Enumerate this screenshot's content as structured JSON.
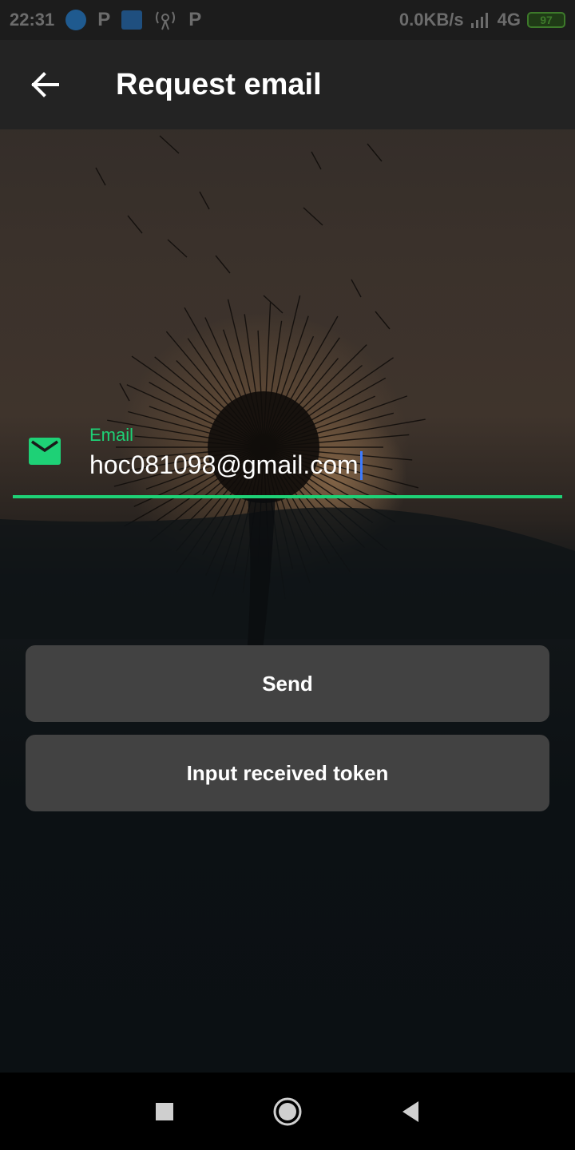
{
  "status_bar": {
    "time": "22:31",
    "net_speed": "0.0KB/s",
    "network": "4G",
    "battery": "97",
    "icons": [
      "wifi-icon",
      "p-notification-icon",
      "hotspot-icon",
      "signal-tower-icon",
      "p-notification-icon",
      "signal-bars-icon",
      "battery-icon"
    ],
    "p_label": "P"
  },
  "app_bar": {
    "title": "Request email",
    "back_icon": "arrow-left-icon"
  },
  "email_field": {
    "label": "Email",
    "value": "hoc081098@gmail.com",
    "icon": "mail-icon",
    "accent_color": "#1ed176"
  },
  "buttons": {
    "send": "Send",
    "token": "Input received token"
  },
  "nav_bar": {
    "icons": [
      "recents-square-icon",
      "home-circle-icon",
      "back-triangle-icon"
    ]
  }
}
